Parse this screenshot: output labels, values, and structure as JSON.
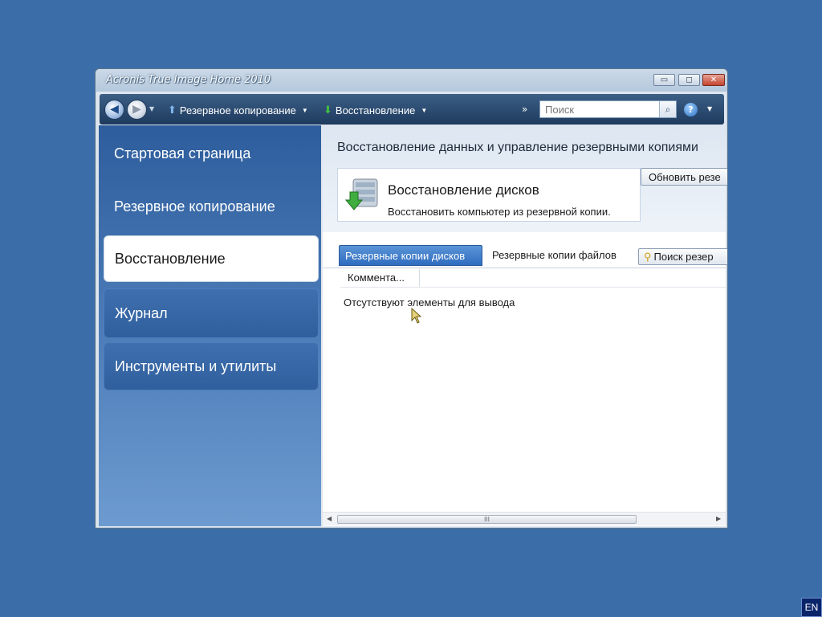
{
  "window": {
    "title": "Acronis True Image Home 2010",
    "controls": {
      "minimize": "▭",
      "maximize": "◻",
      "close": "✕"
    }
  },
  "toolbar": {
    "back_icon": "arrow-left-icon",
    "forward_icon": "arrow-right-icon",
    "backup_label": "Резервное копирование",
    "restore_label": "Восстановление",
    "overflow": "»",
    "search_placeholder": "Поиск",
    "help_label": "?"
  },
  "sidebar": {
    "items": [
      {
        "label": "Стартовая страница",
        "active": false
      },
      {
        "label": "Резервное копирование",
        "active": false
      },
      {
        "label": "Восстановление",
        "active": true
      },
      {
        "label": "Журнал",
        "active": false
      },
      {
        "label": "Инструменты и утилиты",
        "active": false
      }
    ]
  },
  "main": {
    "title": "Восстановление данных и управление резервными копиями",
    "card": {
      "title": "Восстановление дисков",
      "description": "Восстановить компьютер из резервной копии."
    },
    "refresh_button": "Обновить резе",
    "tabs": [
      {
        "label": "Резервные копии дисков",
        "active": true
      },
      {
        "label": "Резервные копии файлов",
        "active": false
      }
    ],
    "search_backups_button": "Поиск резер",
    "columns": [
      "Коммента..."
    ],
    "empty_message": "Отсутствуют элементы для вывода",
    "scrollbar_grip": "III"
  },
  "taskbar": {
    "language": "EN"
  },
  "colors": {
    "desktop": "#3b6ea8",
    "accent": "#2f6cbf",
    "sidebar": "#2d5d9c"
  }
}
